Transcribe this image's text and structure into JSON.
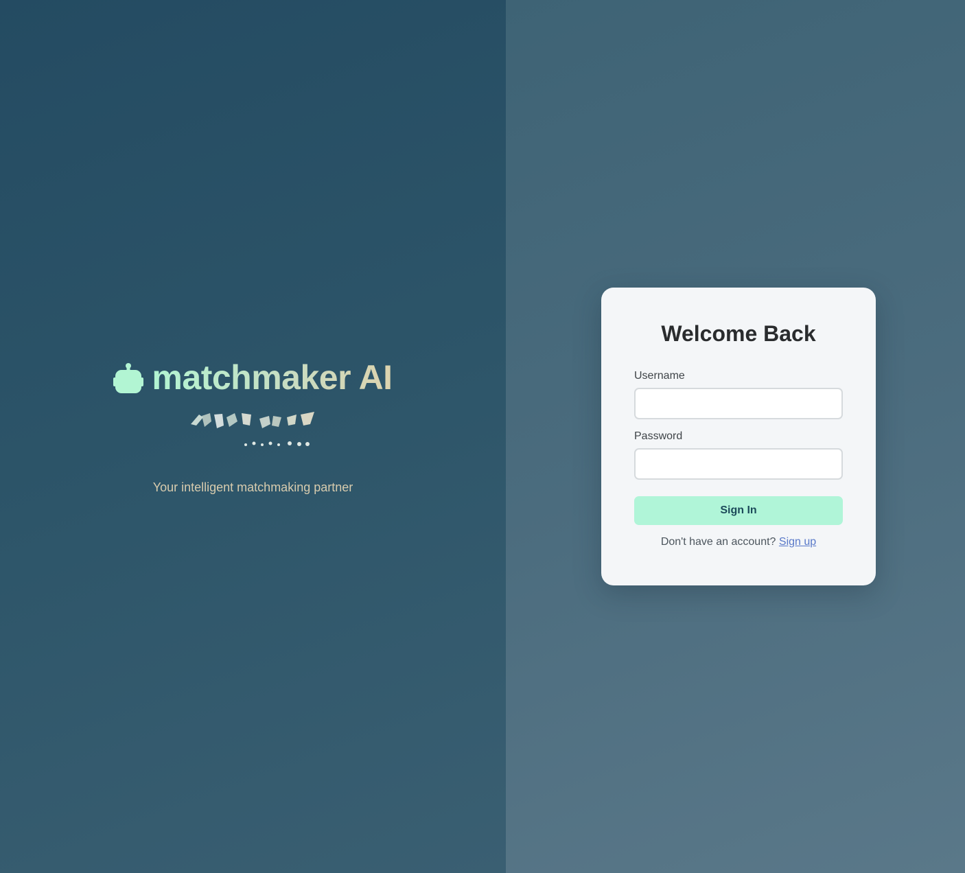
{
  "brand": {
    "icon": "robot-icon",
    "title": "matchmaker AI",
    "tagline": "Your intelligent matchmaking partner",
    "accent": "#b2f5d3"
  },
  "login": {
    "title": "Welcome Back",
    "username_label": "Username",
    "username_value": "",
    "password_label": "Password",
    "password_value": "",
    "submit_label": "Sign In",
    "signup_prompt": "Don't have an account?",
    "signup_link": "Sign up",
    "button_color": "#b0f5d8",
    "link_color": "#5878c8"
  }
}
